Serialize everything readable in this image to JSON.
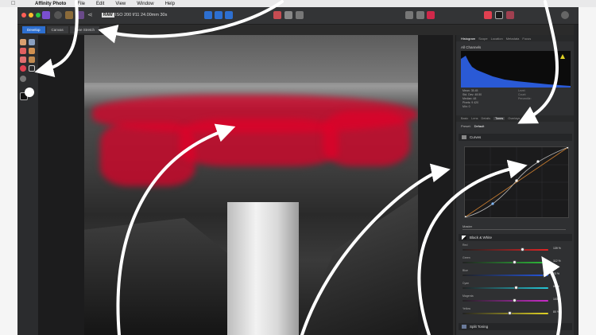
{
  "menubar": {
    "app_name": "Affinity Photo",
    "items": [
      "File",
      "Edit",
      "View",
      "Window",
      "Help"
    ]
  },
  "toolbar": {
    "raw_badge": "RAW",
    "exif": "ISO 200 f/11 24.00mm 30s"
  },
  "personas": [
    {
      "label": "Develop",
      "active": true
    },
    {
      "label": "Canvas",
      "active": false
    },
    {
      "label": "Tone Stretch",
      "active": false
    }
  ],
  "histogram": {
    "tabs": [
      "Histogram",
      "Scope",
      "Location",
      "Metadata",
      "Focus"
    ],
    "channel": "All Channels",
    "stats": [
      "Mean: 35.45",
      "Std. Dev: 48.50",
      "Median: 48",
      "Pixels: 9 420",
      "Min: 0"
    ],
    "stats2": [
      "Level:",
      "Count:",
      "Percentile:"
    ]
  },
  "adjust": {
    "tabs": [
      "Basic",
      "Lens",
      "Details",
      "Tones",
      "Overlays"
    ],
    "active_tab": "Tones",
    "preset_label": "Preset:",
    "preset_value": "Default"
  },
  "curves": {
    "title": "Curves",
    "master_label": "Master"
  },
  "bw": {
    "title": "Black & White",
    "sliders": [
      {
        "label": "Red",
        "value": "139 %",
        "level": 0.69,
        "color": "#e02424"
      },
      {
        "label": "Green",
        "value": "112 %",
        "level": 0.6,
        "color": "#2dbe3a"
      },
      {
        "label": "Blue",
        "value": "23 %",
        "level": 0.95,
        "color": "#2456e0"
      },
      {
        "label": "Cyan",
        "value": "60 %",
        "level": 0.62,
        "color": "#25c6d6"
      },
      {
        "label": "Magenta",
        "value": "103 %",
        "level": 0.6,
        "color": "#c92bc9"
      },
      {
        "label": "Yellow",
        "value": "80 %",
        "level": 0.55,
        "color": "#e0d225"
      }
    ]
  },
  "split_toning": {
    "title": "Split Toning"
  },
  "colors": {
    "accent": "#2d6fd0",
    "mask": "#e10028"
  }
}
